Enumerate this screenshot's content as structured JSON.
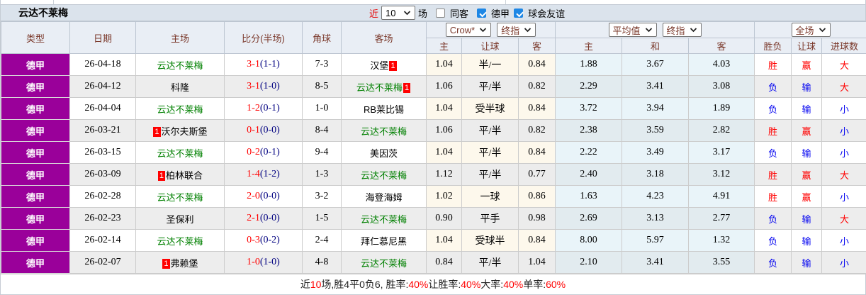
{
  "colors": {
    "league_purple": "#9a009a",
    "team_green": "#008000",
    "score_red": "#ff0000",
    "half_navy": "#000080",
    "win_red": "#ff0000",
    "lose_blue": "#0000f0",
    "checkbox_blue": "#1e87e5",
    "header_text": "#7a382a"
  },
  "title_bar": {
    "team": "云达不莱梅",
    "near_label": "近",
    "games_select_value": "10",
    "games_suffix": "场",
    "checkboxes": [
      {
        "label": "同客",
        "checked": false
      },
      {
        "label": "德甲",
        "checked": true
      },
      {
        "label": "球会友谊",
        "checked": true
      }
    ]
  },
  "header": {
    "left_columns": [
      "类型",
      "日期",
      "主场",
      "比分(半场)",
      "角球",
      "客场"
    ],
    "groups": [
      {
        "selects": [
          "Crow*",
          "终指"
        ],
        "sub": [
          "主",
          "让球",
          "客"
        ]
      },
      {
        "selects": [
          "平均值",
          "终指"
        ],
        "sub": [
          "主",
          "和",
          "客"
        ]
      },
      {
        "selects": [
          "全场"
        ],
        "sub": [
          "胜负",
          "让球",
          "进球数"
        ]
      }
    ]
  },
  "rows": [
    {
      "league": "德甲",
      "date": "26-04-18",
      "home": {
        "name": "云达不莱梅",
        "color": "green"
      },
      "score": "3-1",
      "half": "(1-1)",
      "corners": "7-3",
      "away": {
        "name": "汉堡",
        "color": "black",
        "badge": "1",
        "badge_pos": "after"
      },
      "crow_odds": [
        "1.04",
        "半/一",
        "0.84"
      ],
      "avg_odds": [
        "1.88",
        "3.67",
        "4.03"
      ],
      "results": [
        {
          "text": "胜",
          "color": "red"
        },
        {
          "text": "赢",
          "color": "red"
        },
        {
          "text": "大",
          "color": "red"
        }
      ]
    },
    {
      "league": "德甲",
      "date": "26-04-12",
      "home": {
        "name": "科隆",
        "color": "black"
      },
      "score": "3-1",
      "half": "(1-0)",
      "corners": "8-5",
      "away": {
        "name": "云达不莱梅",
        "color": "green",
        "badge": "1",
        "badge_pos": "after"
      },
      "crow_odds": [
        "1.06",
        "平/半",
        "0.82"
      ],
      "avg_odds": [
        "2.29",
        "3.41",
        "3.08"
      ],
      "results": [
        {
          "text": "负",
          "color": "blue"
        },
        {
          "text": "输",
          "color": "blue"
        },
        {
          "text": "大",
          "color": "red"
        }
      ]
    },
    {
      "league": "德甲",
      "date": "26-04-04",
      "home": {
        "name": "云达不莱梅",
        "color": "green"
      },
      "score": "1-2",
      "half": "(0-1)",
      "corners": "1-0",
      "away": {
        "name": "RB莱比锡",
        "color": "black"
      },
      "crow_odds": [
        "1.04",
        "受半球",
        "0.84"
      ],
      "avg_odds": [
        "3.72",
        "3.94",
        "1.89"
      ],
      "results": [
        {
          "text": "负",
          "color": "blue"
        },
        {
          "text": "输",
          "color": "blue"
        },
        {
          "text": "小",
          "color": "blue"
        }
      ]
    },
    {
      "league": "德甲",
      "date": "26-03-21",
      "home": {
        "name": "沃尔夫斯堡",
        "color": "black",
        "badge": "1",
        "badge_pos": "before"
      },
      "score": "0-1",
      "half": "(0-0)",
      "corners": "8-4",
      "away": {
        "name": "云达不莱梅",
        "color": "green"
      },
      "crow_odds": [
        "1.06",
        "平/半",
        "0.82"
      ],
      "avg_odds": [
        "2.38",
        "3.59",
        "2.82"
      ],
      "results": [
        {
          "text": "胜",
          "color": "red"
        },
        {
          "text": "赢",
          "color": "red"
        },
        {
          "text": "小",
          "color": "blue"
        }
      ]
    },
    {
      "league": "德甲",
      "date": "26-03-15",
      "home": {
        "name": "云达不莱梅",
        "color": "green"
      },
      "score": "0-2",
      "half": "(0-1)",
      "corners": "9-4",
      "away": {
        "name": "美因茨",
        "color": "black"
      },
      "crow_odds": [
        "1.04",
        "平/半",
        "0.84"
      ],
      "avg_odds": [
        "2.22",
        "3.49",
        "3.17"
      ],
      "results": [
        {
          "text": "负",
          "color": "blue"
        },
        {
          "text": "输",
          "color": "blue"
        },
        {
          "text": "小",
          "color": "blue"
        }
      ]
    },
    {
      "league": "德甲",
      "date": "26-03-09",
      "home": {
        "name": "柏林联合",
        "color": "black",
        "badge": "1",
        "badge_pos": "before"
      },
      "score": "1-4",
      "half": "(1-2)",
      "corners": "1-3",
      "away": {
        "name": "云达不莱梅",
        "color": "green"
      },
      "crow_odds": [
        "1.12",
        "平/半",
        "0.77"
      ],
      "avg_odds": [
        "2.40",
        "3.18",
        "3.12"
      ],
      "results": [
        {
          "text": "胜",
          "color": "red"
        },
        {
          "text": "赢",
          "color": "red"
        },
        {
          "text": "大",
          "color": "red"
        }
      ]
    },
    {
      "league": "德甲",
      "date": "26-02-28",
      "home": {
        "name": "云达不莱梅",
        "color": "green"
      },
      "score": "2-0",
      "half": "(0-0)",
      "corners": "3-2",
      "away": {
        "name": "海登海姆",
        "color": "black"
      },
      "crow_odds": [
        "1.02",
        "一球",
        "0.86"
      ],
      "avg_odds": [
        "1.63",
        "4.23",
        "4.91"
      ],
      "results": [
        {
          "text": "胜",
          "color": "red"
        },
        {
          "text": "赢",
          "color": "red"
        },
        {
          "text": "小",
          "color": "blue"
        }
      ]
    },
    {
      "league": "德甲",
      "date": "26-02-23",
      "home": {
        "name": "圣保利",
        "color": "black"
      },
      "score": "2-1",
      "half": "(0-0)",
      "corners": "1-5",
      "away": {
        "name": "云达不莱梅",
        "color": "green"
      },
      "crow_odds": [
        "0.90",
        "平手",
        "0.98"
      ],
      "avg_odds": [
        "2.69",
        "3.13",
        "2.77"
      ],
      "results": [
        {
          "text": "负",
          "color": "blue"
        },
        {
          "text": "输",
          "color": "blue"
        },
        {
          "text": "大",
          "color": "red"
        }
      ]
    },
    {
      "league": "德甲",
      "date": "26-02-14",
      "home": {
        "name": "云达不莱梅",
        "color": "green"
      },
      "score": "0-3",
      "half": "(0-2)",
      "corners": "2-4",
      "away": {
        "name": "拜仁慕尼黑",
        "color": "black"
      },
      "crow_odds": [
        "1.04",
        "受球半",
        "0.84"
      ],
      "avg_odds": [
        "8.00",
        "5.97",
        "1.32"
      ],
      "results": [
        {
          "text": "负",
          "color": "blue"
        },
        {
          "text": "输",
          "color": "blue"
        },
        {
          "text": "小",
          "color": "blue"
        }
      ]
    },
    {
      "league": "德甲",
      "date": "26-02-07",
      "home": {
        "name": "弗赖堡",
        "color": "black",
        "badge": "1",
        "badge_pos": "before"
      },
      "score": "1-0",
      "half": "(1-0)",
      "corners": "4-8",
      "away": {
        "name": "云达不莱梅",
        "color": "green"
      },
      "crow_odds": [
        "0.84",
        "平/半",
        "1.04"
      ],
      "avg_odds": [
        "2.10",
        "3.41",
        "3.55"
      ],
      "results": [
        {
          "text": "负",
          "color": "blue"
        },
        {
          "text": "输",
          "color": "blue"
        },
        {
          "text": "小",
          "color": "blue"
        }
      ]
    }
  ],
  "footer": {
    "parts": [
      {
        "text": "近",
        "red": false
      },
      {
        "text": "10",
        "red": true
      },
      {
        "text": "场,胜4平0负6, 胜率:",
        "red": false
      },
      {
        "text": "40%",
        "red": true
      },
      {
        "text": " 让胜率:",
        "red": false
      },
      {
        "text": "40%",
        "red": true
      },
      {
        "text": " 大率:",
        "red": false
      },
      {
        "text": "40%",
        "red": true
      },
      {
        "text": " 单率:",
        "red": false
      },
      {
        "text": "60%",
        "red": true
      }
    ]
  }
}
